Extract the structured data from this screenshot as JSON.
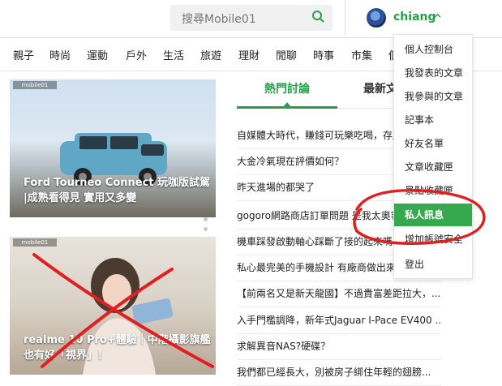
{
  "header": {
    "search_placeholder": "搜尋Mobile01",
    "username": "chiang"
  },
  "nav": {
    "items": [
      "親子",
      "時尚",
      "運動",
      "戶外",
      "生活",
      "旅遊",
      "理財",
      "閒聊",
      "時事",
      "市集",
      "個"
    ]
  },
  "cards": [
    {
      "badge": "mobile01",
      "title_line1": "Ford Tourneo Connect 玩咖版試駕",
      "title_line2": "|成熟看得見 實用又多變"
    },
    {
      "badge": "mobile01",
      "title_line1": "realme 10 Pro+體驗｜中階攝影旗艦",
      "title_line2": "也有好「視界」！"
    }
  ],
  "tabs": {
    "hot": "熱門討論",
    "latest": "最新文章"
  },
  "topics": [
    "自媒體大時代，賺錢可玩樂吃喝，存版稅",
    "大金冷氣現在評價如何？",
    "昨天進場的都哭了",
    "gogoro網路商店訂單問題 是我太奧客嗎",
    "機車踩發啟動軸心踩斷了接的起來嗎",
    "私心最完美的手機設計 有廠商做出來嗎",
    "【前兩名又是新天龍國】不過貴富差距拉大，...",
    "入手門檻調降，新年式Jaguar I-Pace EV400 ...",
    "求解異音NAS?硬碟？",
    "我們都已經長大，別被房子綁住年輕的翅膀..."
  ],
  "dropdown": {
    "items": [
      "個人控制台",
      "我發表的文章",
      "我參與的文章",
      "記事本",
      "好友名單",
      "文章收藏匣",
      "景點收藏匣",
      "私人訊息",
      "增加帳號安全",
      "登出"
    ],
    "active_index": 7
  },
  "colors": {
    "accent_green": "#2a9d4a",
    "menu_active_bg": "#36a94f",
    "annotation_red": "#e02020"
  }
}
